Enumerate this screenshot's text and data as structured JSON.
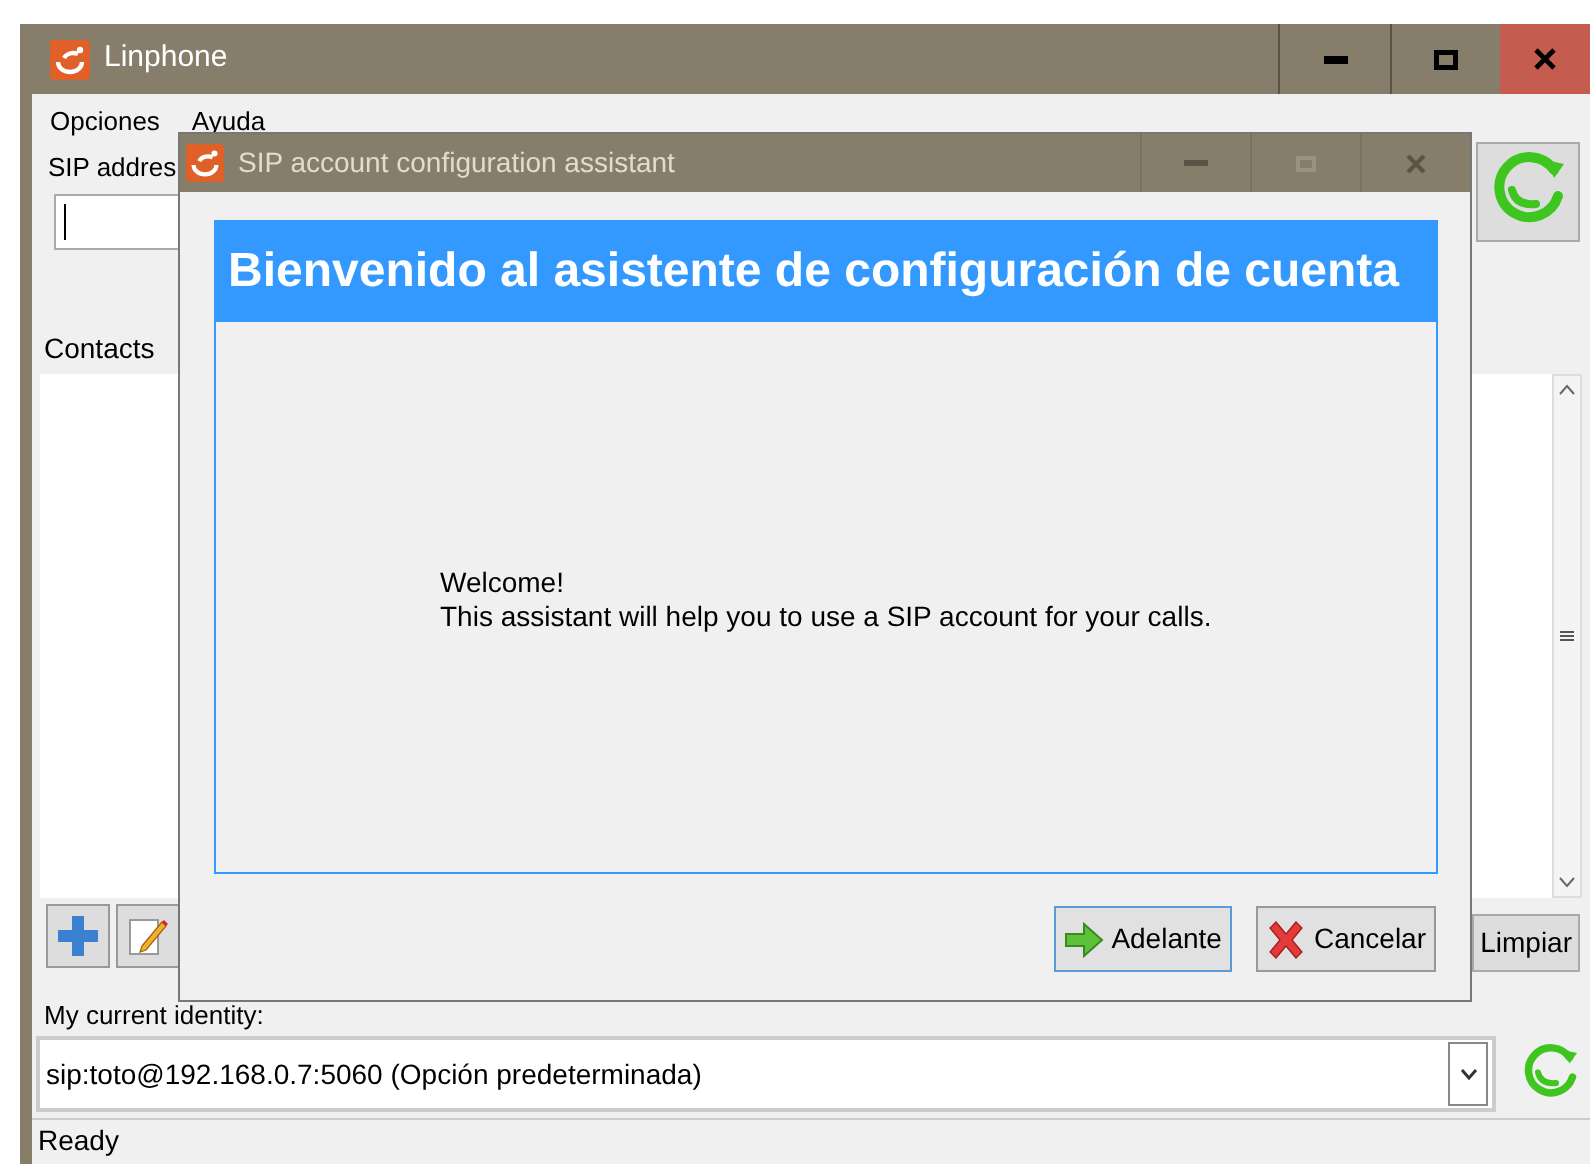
{
  "main_window": {
    "title": "Linphone",
    "menu": [
      {
        "label": "Opciones"
      },
      {
        "label": "Ayuda"
      }
    ],
    "sip_address_label": "SIP addres",
    "contacts_label": "Contacts",
    "clear_button": "Limpiar",
    "identity_label": "My current identity:",
    "identity_value": "sip:toto@192.168.0.7:5060 (Opción predeterminada)",
    "status": "Ready"
  },
  "dialog": {
    "title": "SIP account configuration assistant",
    "heading": "Bienvenido al asistente de configuración de cuenta",
    "message_lines": [
      "Welcome!",
      "This assistant will help you to use a SIP account for your calls."
    ],
    "buttons": [
      {
        "label": "Adelante",
        "kind": "forward",
        "focused": true
      },
      {
        "label": "Cancelar",
        "kind": "cancel",
        "focused": false
      }
    ]
  }
}
